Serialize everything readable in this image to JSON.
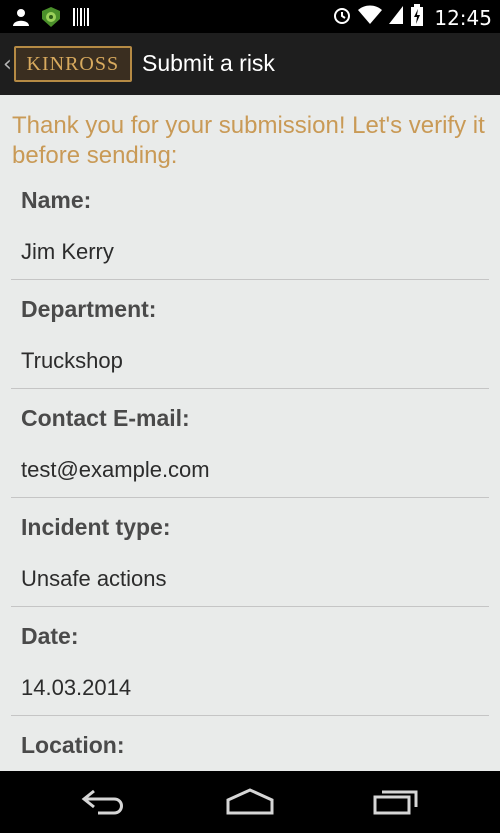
{
  "status_bar": {
    "time": "12:45",
    "icons": [
      "person-icon",
      "android-badge-icon",
      "barcode-icon",
      "alarm-icon",
      "wifi-icon",
      "signal-icon",
      "battery-charging-icon"
    ]
  },
  "action_bar": {
    "logo_text": "KINROSS",
    "title": "Submit a risk"
  },
  "intro": "Thank you for your submission! Let's verify it before sending:",
  "fields": [
    {
      "label": "Name:",
      "value": "Jim Kerry"
    },
    {
      "label": "Department:",
      "value": "Truckshop"
    },
    {
      "label": "Contact E-mail:",
      "value": "test@example.com"
    },
    {
      "label": "Incident type:",
      "value": "Unsafe actions"
    },
    {
      "label": "Date:",
      "value": "14.03.2014"
    },
    {
      "label": "Location:",
      "value": ""
    }
  ],
  "nav_bar": {
    "buttons": [
      "back-icon",
      "home-icon",
      "recent-apps-icon"
    ]
  },
  "colors": {
    "accent": "#c99a56",
    "action_bar": "#1e1e1e",
    "background": "#e9ebea"
  }
}
